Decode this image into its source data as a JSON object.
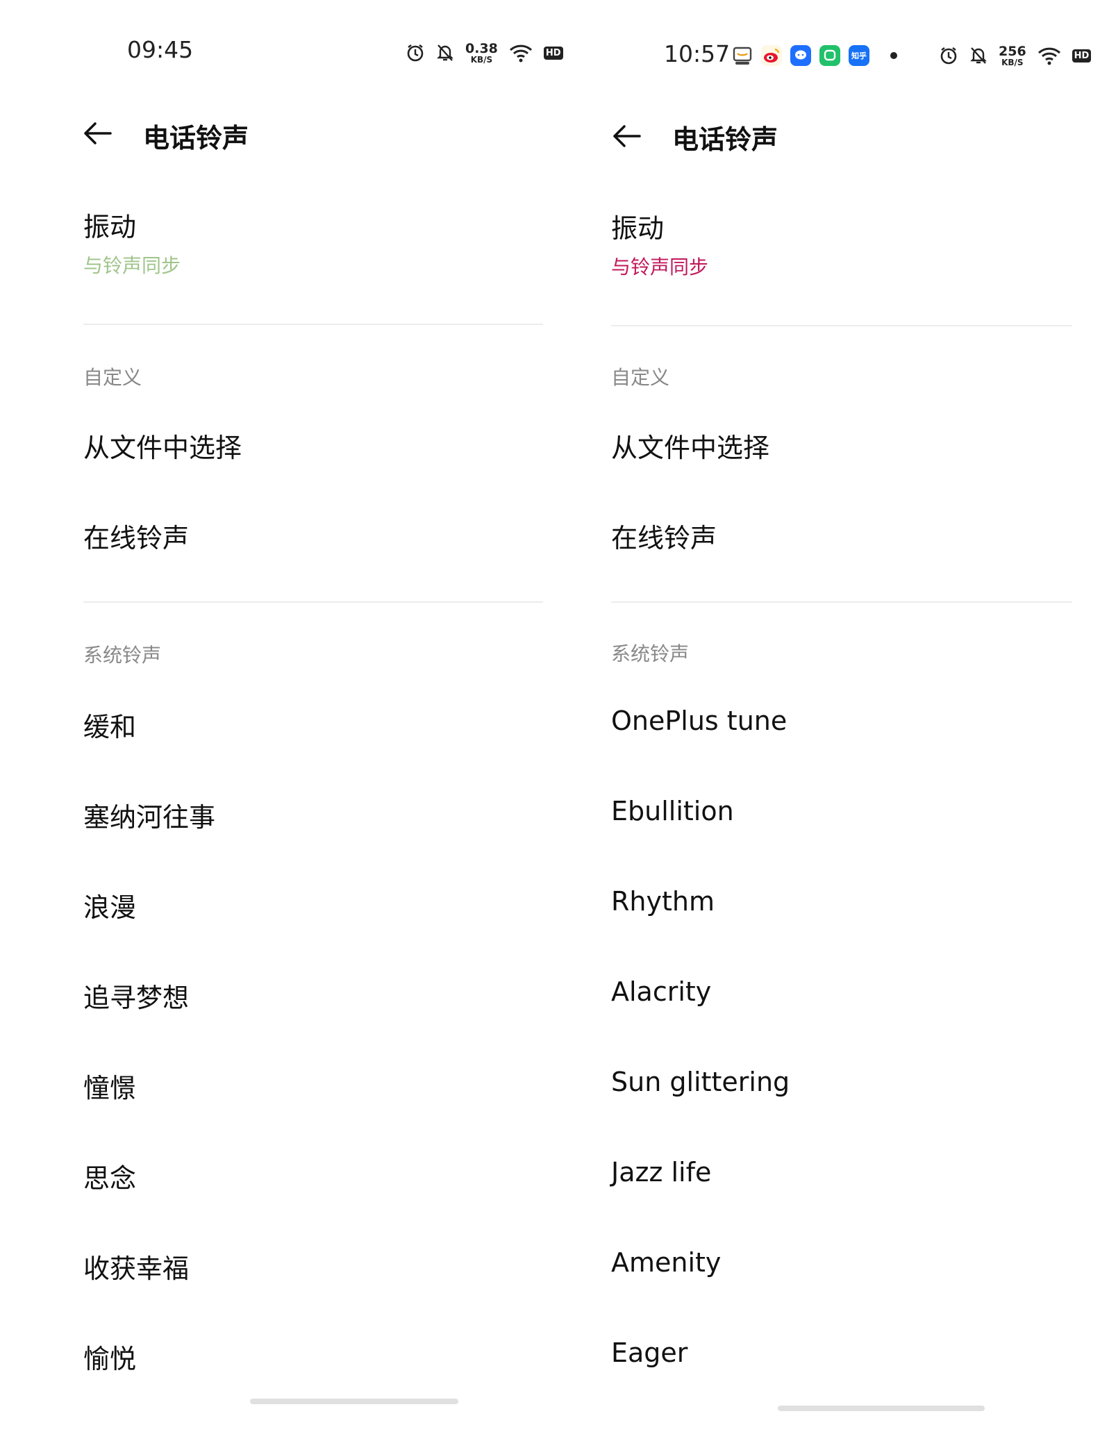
{
  "left": {
    "status": {
      "time": "09:45",
      "speed_value": "0.38",
      "speed_unit": "KB/S",
      "hd": "HD"
    },
    "title": "电话铃声",
    "vibration": {
      "label": "振动",
      "value": "与铃声同步",
      "value_color": "#9fc48a"
    },
    "custom_section": "自定义",
    "custom_items": [
      "从文件中选择",
      "在线铃声"
    ],
    "system_section": "系统铃声",
    "ringtones": [
      "缓和",
      "塞纳河往事",
      "浪漫",
      "追寻梦想",
      "憧憬",
      "思念",
      "收获幸福",
      "愉悦"
    ]
  },
  "right": {
    "status": {
      "time": "10:57",
      "speed_value": "256",
      "speed_unit": "KB/S",
      "hd": "HD",
      "zhihu_label": "知乎"
    },
    "title": "电话铃声",
    "vibration": {
      "label": "振动",
      "value": "与铃声同步",
      "value_color": "#c2185b"
    },
    "custom_section": "自定义",
    "custom_items": [
      "从文件中选择",
      "在线铃声"
    ],
    "system_section": "系统铃声",
    "ringtones": [
      "OnePlus tune",
      "Ebullition",
      "Rhythm",
      "Alacrity",
      "Sun glittering",
      "Jazz life",
      "Amenity",
      "Eager"
    ]
  }
}
